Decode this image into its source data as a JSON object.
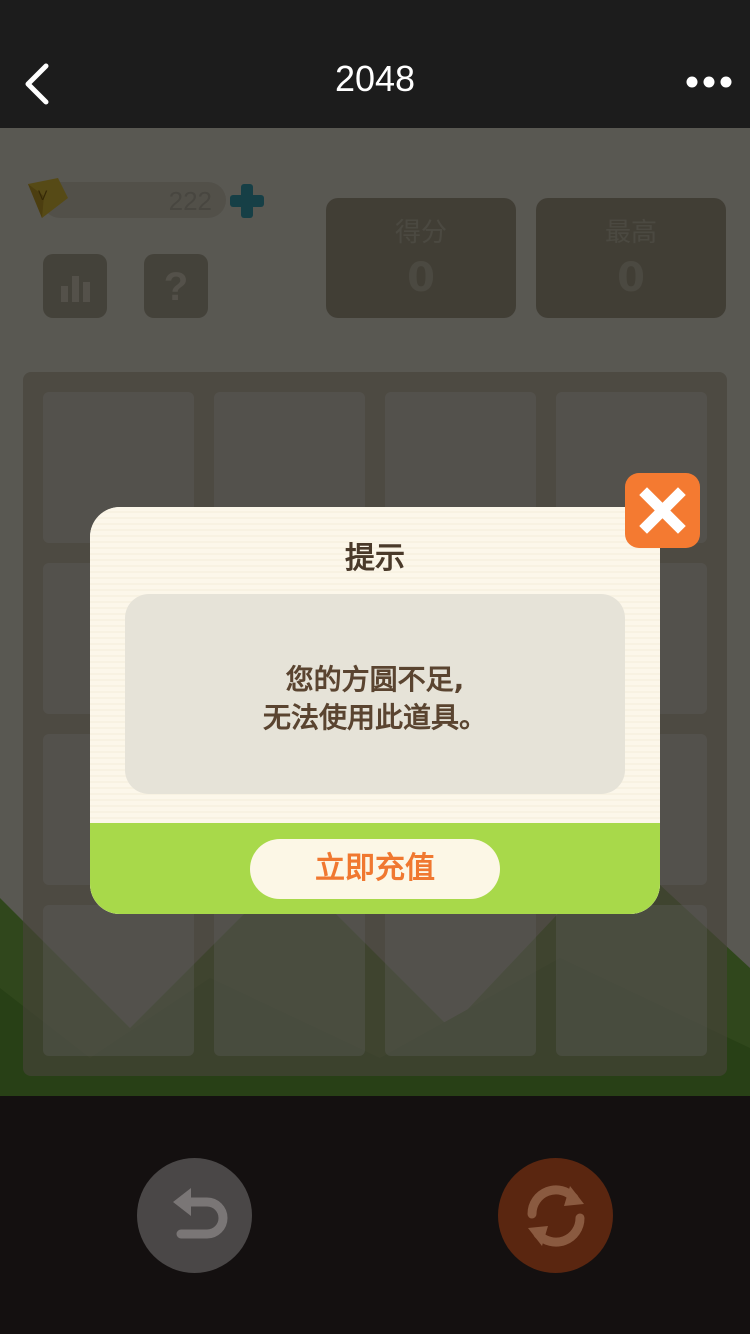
{
  "header": {
    "title": "2048",
    "back_icon": "chevron-left-icon",
    "more_icon": "more-dots-icon"
  },
  "game": {
    "gems": "222",
    "score_label": "得分",
    "score_value": "0",
    "best_label": "最高",
    "best_value": "0",
    "board_size": 4
  },
  "dialog": {
    "title": "提示",
    "message_line1": "您的方圆不足,",
    "message_line2": "无法使用此道具。",
    "action_label": "立即充值",
    "close_icon": "close-x-icon"
  },
  "colors": {
    "accent_orange": "#f47a31",
    "footer_green": "#a8d94a",
    "topbar": "#1c1c1c"
  }
}
